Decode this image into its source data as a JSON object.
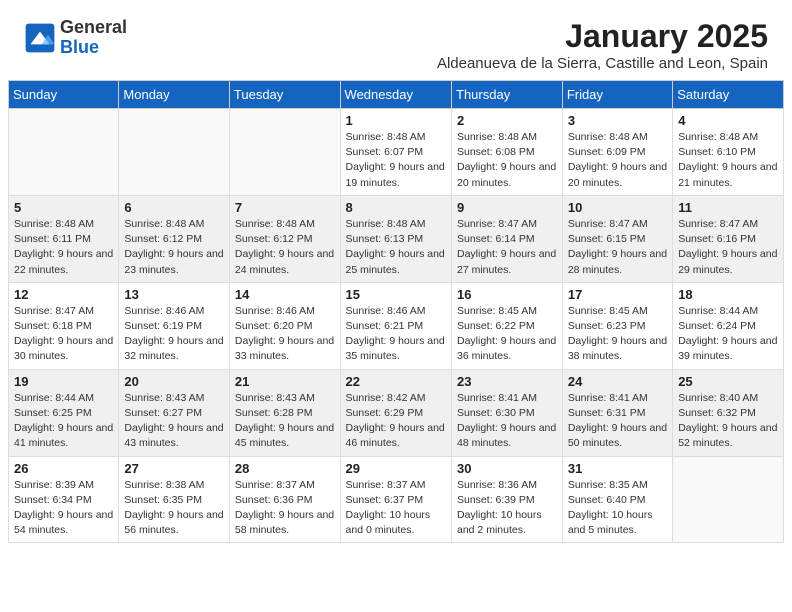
{
  "logo": {
    "general": "General",
    "blue": "Blue"
  },
  "header": {
    "month": "January 2025",
    "location": "Aldeanueva de la Sierra, Castille and Leon, Spain"
  },
  "weekdays": [
    "Sunday",
    "Monday",
    "Tuesday",
    "Wednesday",
    "Thursday",
    "Friday",
    "Saturday"
  ],
  "weeks": [
    [
      {
        "day": "",
        "info": ""
      },
      {
        "day": "",
        "info": ""
      },
      {
        "day": "",
        "info": ""
      },
      {
        "day": "1",
        "info": "Sunrise: 8:48 AM\nSunset: 6:07 PM\nDaylight: 9 hours and 19 minutes."
      },
      {
        "day": "2",
        "info": "Sunrise: 8:48 AM\nSunset: 6:08 PM\nDaylight: 9 hours and 20 minutes."
      },
      {
        "day": "3",
        "info": "Sunrise: 8:48 AM\nSunset: 6:09 PM\nDaylight: 9 hours and 20 minutes."
      },
      {
        "day": "4",
        "info": "Sunrise: 8:48 AM\nSunset: 6:10 PM\nDaylight: 9 hours and 21 minutes."
      }
    ],
    [
      {
        "day": "5",
        "info": "Sunrise: 8:48 AM\nSunset: 6:11 PM\nDaylight: 9 hours and 22 minutes."
      },
      {
        "day": "6",
        "info": "Sunrise: 8:48 AM\nSunset: 6:12 PM\nDaylight: 9 hours and 23 minutes."
      },
      {
        "day": "7",
        "info": "Sunrise: 8:48 AM\nSunset: 6:12 PM\nDaylight: 9 hours and 24 minutes."
      },
      {
        "day": "8",
        "info": "Sunrise: 8:48 AM\nSunset: 6:13 PM\nDaylight: 9 hours and 25 minutes."
      },
      {
        "day": "9",
        "info": "Sunrise: 8:47 AM\nSunset: 6:14 PM\nDaylight: 9 hours and 27 minutes."
      },
      {
        "day": "10",
        "info": "Sunrise: 8:47 AM\nSunset: 6:15 PM\nDaylight: 9 hours and 28 minutes."
      },
      {
        "day": "11",
        "info": "Sunrise: 8:47 AM\nSunset: 6:16 PM\nDaylight: 9 hours and 29 minutes."
      }
    ],
    [
      {
        "day": "12",
        "info": "Sunrise: 8:47 AM\nSunset: 6:18 PM\nDaylight: 9 hours and 30 minutes."
      },
      {
        "day": "13",
        "info": "Sunrise: 8:46 AM\nSunset: 6:19 PM\nDaylight: 9 hours and 32 minutes."
      },
      {
        "day": "14",
        "info": "Sunrise: 8:46 AM\nSunset: 6:20 PM\nDaylight: 9 hours and 33 minutes."
      },
      {
        "day": "15",
        "info": "Sunrise: 8:46 AM\nSunset: 6:21 PM\nDaylight: 9 hours and 35 minutes."
      },
      {
        "day": "16",
        "info": "Sunrise: 8:45 AM\nSunset: 6:22 PM\nDaylight: 9 hours and 36 minutes."
      },
      {
        "day": "17",
        "info": "Sunrise: 8:45 AM\nSunset: 6:23 PM\nDaylight: 9 hours and 38 minutes."
      },
      {
        "day": "18",
        "info": "Sunrise: 8:44 AM\nSunset: 6:24 PM\nDaylight: 9 hours and 39 minutes."
      }
    ],
    [
      {
        "day": "19",
        "info": "Sunrise: 8:44 AM\nSunset: 6:25 PM\nDaylight: 9 hours and 41 minutes."
      },
      {
        "day": "20",
        "info": "Sunrise: 8:43 AM\nSunset: 6:27 PM\nDaylight: 9 hours and 43 minutes."
      },
      {
        "day": "21",
        "info": "Sunrise: 8:43 AM\nSunset: 6:28 PM\nDaylight: 9 hours and 45 minutes."
      },
      {
        "day": "22",
        "info": "Sunrise: 8:42 AM\nSunset: 6:29 PM\nDaylight: 9 hours and 46 minutes."
      },
      {
        "day": "23",
        "info": "Sunrise: 8:41 AM\nSunset: 6:30 PM\nDaylight: 9 hours and 48 minutes."
      },
      {
        "day": "24",
        "info": "Sunrise: 8:41 AM\nSunset: 6:31 PM\nDaylight: 9 hours and 50 minutes."
      },
      {
        "day": "25",
        "info": "Sunrise: 8:40 AM\nSunset: 6:32 PM\nDaylight: 9 hours and 52 minutes."
      }
    ],
    [
      {
        "day": "26",
        "info": "Sunrise: 8:39 AM\nSunset: 6:34 PM\nDaylight: 9 hours and 54 minutes."
      },
      {
        "day": "27",
        "info": "Sunrise: 8:38 AM\nSunset: 6:35 PM\nDaylight: 9 hours and 56 minutes."
      },
      {
        "day": "28",
        "info": "Sunrise: 8:37 AM\nSunset: 6:36 PM\nDaylight: 9 hours and 58 minutes."
      },
      {
        "day": "29",
        "info": "Sunrise: 8:37 AM\nSunset: 6:37 PM\nDaylight: 10 hours and 0 minutes."
      },
      {
        "day": "30",
        "info": "Sunrise: 8:36 AM\nSunset: 6:39 PM\nDaylight: 10 hours and 2 minutes."
      },
      {
        "day": "31",
        "info": "Sunrise: 8:35 AM\nSunset: 6:40 PM\nDaylight: 10 hours and 5 minutes."
      },
      {
        "day": "",
        "info": ""
      }
    ]
  ]
}
